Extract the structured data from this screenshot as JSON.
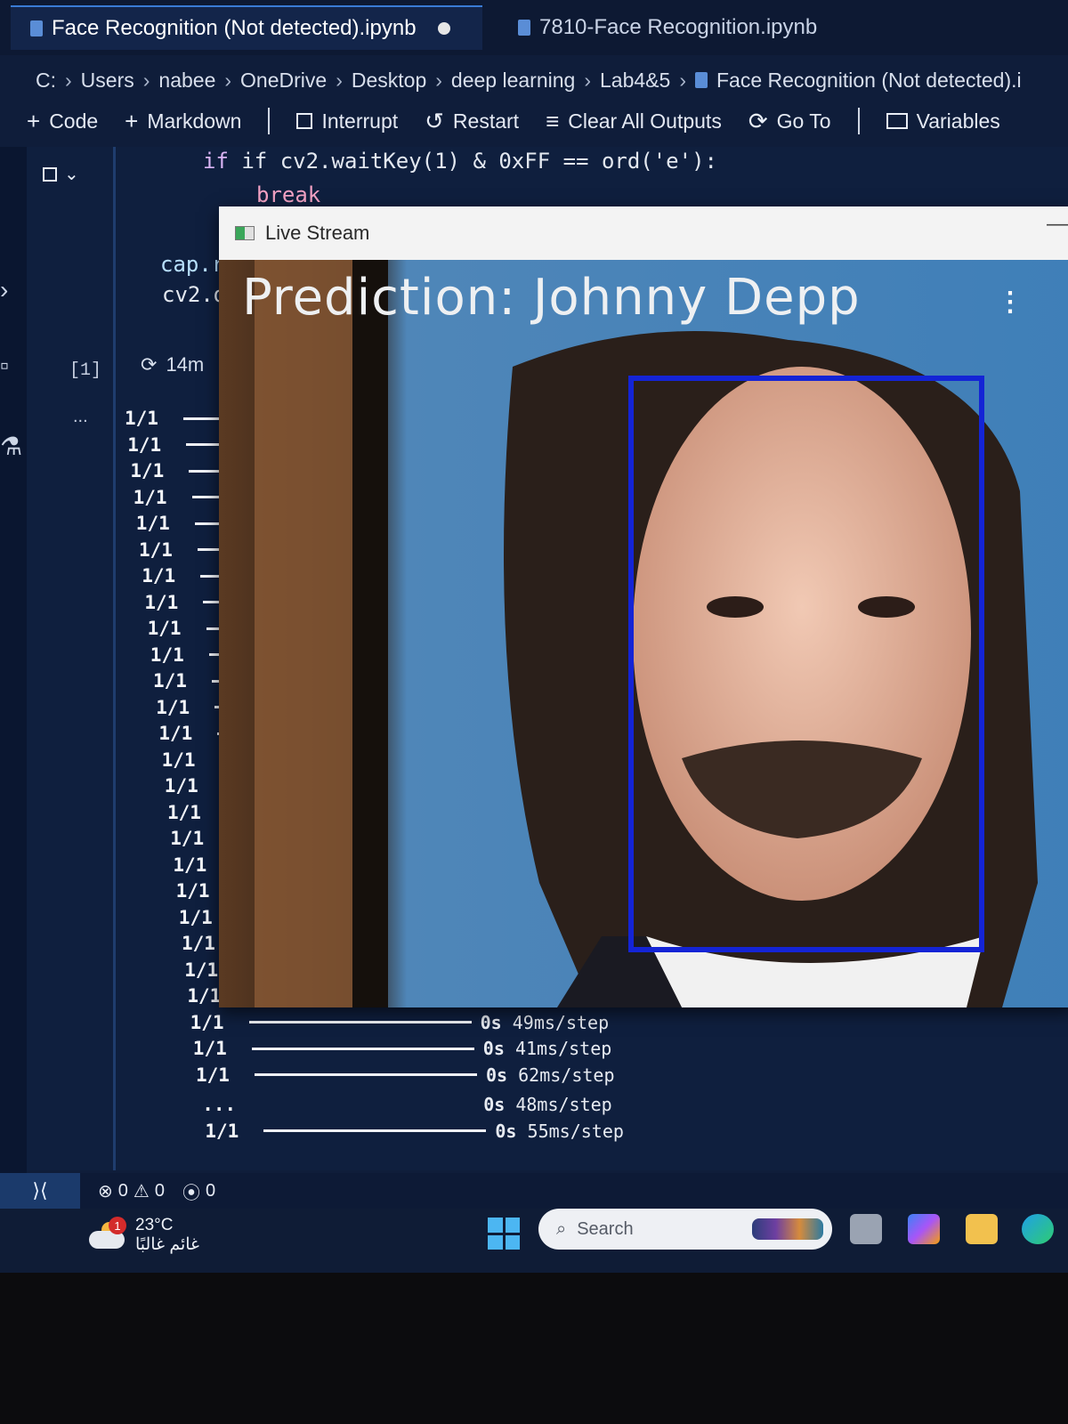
{
  "tabs": [
    {
      "label": "Face Recognition (Not detected).ipynb",
      "active": true,
      "modified": true
    },
    {
      "label": "7810-Face Recognition.ipynb",
      "active": false,
      "modified": false
    }
  ],
  "breadcrumb": [
    "C:",
    "Users",
    "nabee",
    "OneDrive",
    "Desktop",
    "deep learning",
    "Lab4&5",
    "Face Recognition (Not detected).i"
  ],
  "toolbar": {
    "code": "Code",
    "markdown": "Markdown",
    "interrupt": "Interrupt",
    "restart": "Restart",
    "clear_all": "Clear All Outputs",
    "go_to": "Go To",
    "variables": "Variables"
  },
  "cell": {
    "code_line1": "if cv2.waitKey(1) & 0xFF == ord('e'):",
    "code_line2": "break",
    "code_line3": "cap.r",
    "code_line4": "cv2.d",
    "exec_count": "[1]",
    "exec_time": "14m",
    "more": "..."
  },
  "output": {
    "step": "1/1",
    "ellipsis": "...",
    "timings": [
      {
        "s": "0s",
        "ms": "62ms/step"
      },
      {
        "s": "0s",
        "ms": "49ms/step"
      },
      {
        "s": "0s",
        "ms": "41ms/step"
      },
      {
        "s": "0s",
        "ms": "62ms/step"
      },
      {
        "s": "0s",
        "ms": "48ms/step"
      },
      {
        "s": "0s",
        "ms": "55ms/step"
      }
    ]
  },
  "live_window": {
    "title": "Live Stream",
    "prediction": "Prediction: Johnny Depp",
    "box_color": "#1424d6"
  },
  "statusbar": {
    "errors": "0",
    "warnings": "0",
    "ports": "0"
  },
  "taskbar": {
    "weather_badge": "1",
    "temperature": "23°C",
    "weather_desc": "غائم غالبًا",
    "search_label": "Search"
  },
  "icons": [
    "notebook-icon",
    "plus-icon",
    "square-icon",
    "restart-icon",
    "clear-icon",
    "refresh-icon",
    "variables-icon",
    "account-icon",
    "gear-icon",
    "remote-icon",
    "error-icon",
    "warning-icon",
    "ports-icon",
    "search-icon",
    "windows-start-icon"
  ]
}
